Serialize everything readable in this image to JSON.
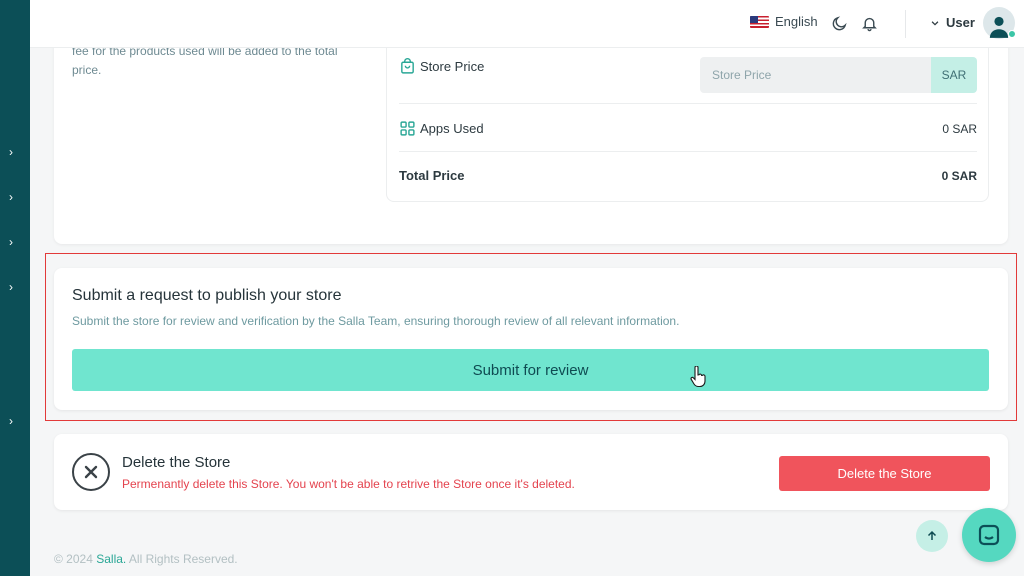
{
  "header": {
    "language": "English",
    "user_label": "User"
  },
  "price_card": {
    "description": "fee for the products used will be added to the total price.",
    "store_price_label": "Store Price",
    "store_price_placeholder": "Store Price",
    "currency_suffix": "SAR",
    "apps_used_label": "Apps Used",
    "apps_used_value": "0 SAR",
    "total_price_label": "Total Price",
    "total_price_value": "0 SAR"
  },
  "publish_card": {
    "title": "Submit a request to publish your store",
    "description": "Submit the store for review and verification by the Salla Team, ensuring thorough review of all relevant information.",
    "submit_label": "Submit for review"
  },
  "delete_card": {
    "title": "Delete the Store",
    "description": "Permenantly delete this Store. You won't be able to retrive the Store once it's deleted.",
    "button_label": "Delete the Store"
  },
  "footer": {
    "copyright_prefix": "© 2024",
    "brand": "Salla.",
    "rights": "All Rights Reserved."
  },
  "colors": {
    "sidebar": "#0c4f57",
    "accent": "#70e5cf",
    "danger": "#f0545c",
    "highlight_border": "#e23a3a"
  },
  "icons": {
    "sidebar": "chevron-right-icon",
    "theme": "moon-icon",
    "notifications": "bell-icon",
    "user_menu": "chevron-down-icon",
    "store_price": "shopping-bag-icon",
    "apps": "apps-grid-icon",
    "delete": "close-circle-icon",
    "scroll_top": "arrow-up-icon",
    "chat": "chat-icon"
  }
}
